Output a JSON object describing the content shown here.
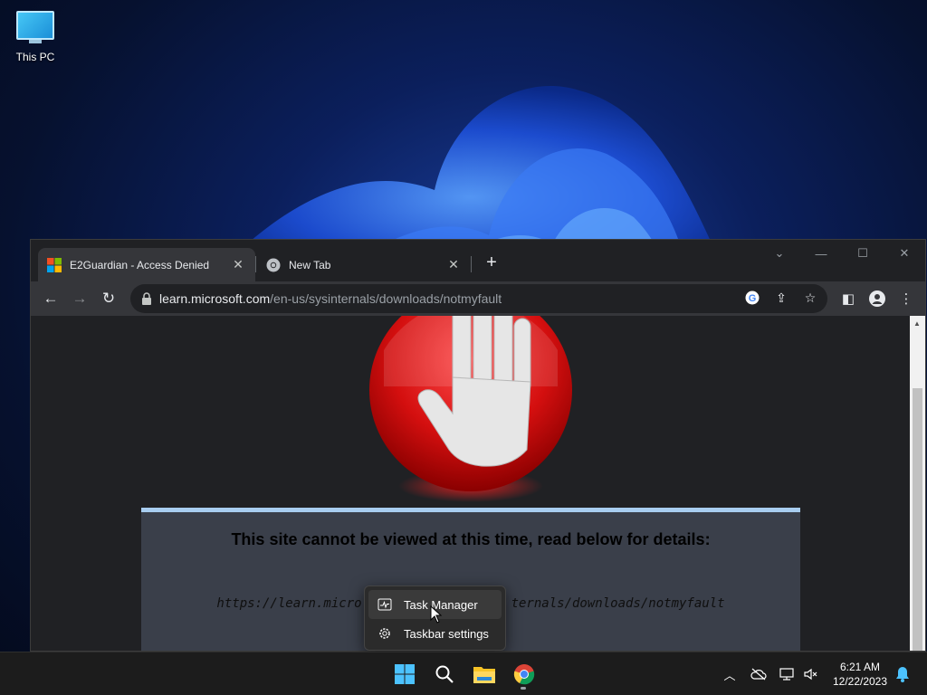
{
  "desktop": {
    "icons": [
      {
        "label": "This PC",
        "icon": "monitor-icon"
      }
    ]
  },
  "browser": {
    "tabs": [
      {
        "title": "E2Guardian - Access Denied",
        "icon": "microsoft-logo-icon",
        "active": true
      },
      {
        "title": "New Tab",
        "icon": "chrome-icon",
        "active": false
      }
    ],
    "address": {
      "host": "learn.microsoft.com",
      "path": "/en-us/sysinternals/downloads/notmyfault"
    },
    "page": {
      "heading": "This site cannot be viewed at this time, read below for details:",
      "blocked_url": "https://learn.micro",
      "blocked_url_tail": "ternals/downloads/notmyfault"
    }
  },
  "context_menu": {
    "items": [
      {
        "label": "Task Manager",
        "icon": "activity-monitor-icon"
      },
      {
        "label": "Taskbar settings",
        "icon": "gear-icon"
      }
    ]
  },
  "taskbar": {
    "apps": [
      "start-icon",
      "search-icon",
      "file-explorer-icon",
      "chrome-icon"
    ],
    "tray_icons": [
      "chevron-up-icon",
      "onedrive-offline-icon",
      "network-icon",
      "volume-muted-icon",
      "notification-bell-icon"
    ],
    "clock": {
      "time": "6:21 AM",
      "date": "12/22/2023"
    }
  },
  "colors": {
    "panel_accent": "#a8cdf0",
    "stop_sign_red": "#e01b1b",
    "window_bg": "#202124",
    "toolbar_bg": "#35363a"
  }
}
